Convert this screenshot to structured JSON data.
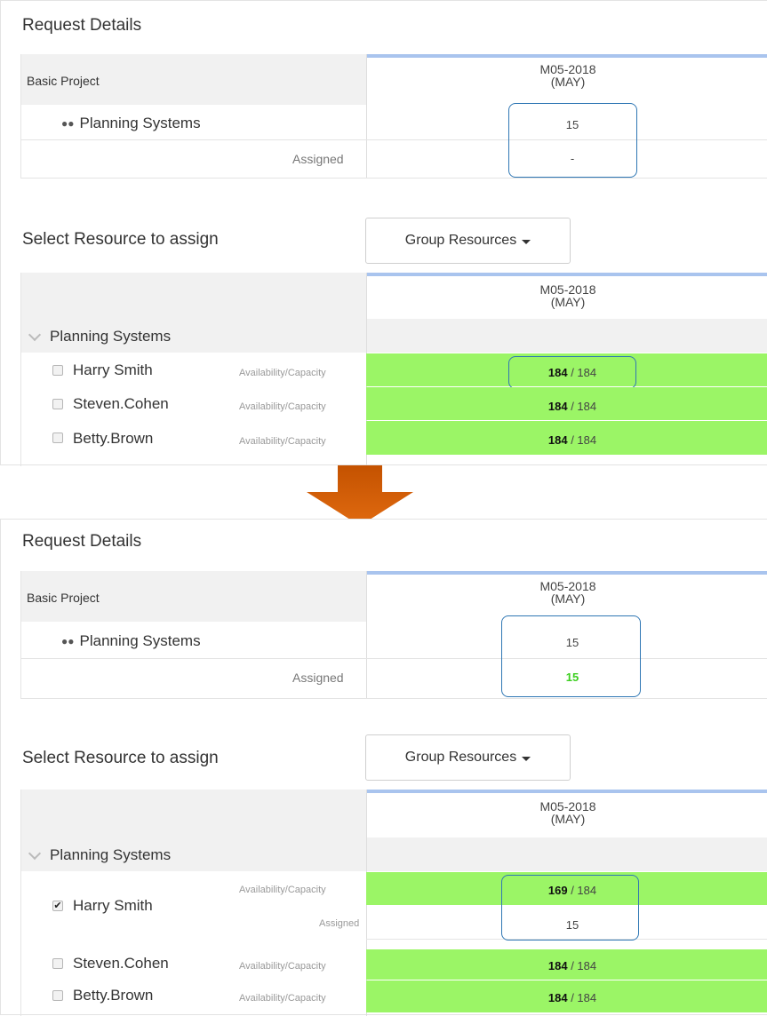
{
  "top": {
    "title": "Request Details",
    "project_name": "Basic Project",
    "group_name": "Planning Systems",
    "assigned_label": "Assigned",
    "month_label": "M05-2018",
    "month_sub": "(MAY)",
    "requested_value": "15",
    "assigned_value": "-",
    "select_label": "Select Resource to assign",
    "group_button": "Group Resources",
    "resource_group": "Planning Systems",
    "resources": [
      {
        "name": "Harry Smith",
        "label": "Availability/Capacity",
        "available": "184",
        "capacity": "184"
      },
      {
        "name": "Steven.Cohen",
        "label": "Availability/Capacity",
        "available": "184",
        "capacity": "184"
      },
      {
        "name": "Betty.Brown",
        "label": "Availability/Capacity",
        "available": "184",
        "capacity": "184"
      }
    ]
  },
  "bottom": {
    "title": "Request Details",
    "project_name": "Basic Project",
    "group_name": "Planning Systems",
    "assigned_label": "Assigned",
    "month_label": "M05-2018",
    "month_sub": "(MAY)",
    "requested_value": "15",
    "assigned_value": "15",
    "select_label": "Select Resource to assign",
    "group_button": "Group Resources",
    "resource_group": "Planning Systems",
    "harry": {
      "name": "Harry Smith",
      "label": "Availability/Capacity",
      "available": "169",
      "capacity": "184",
      "assigned_label": "Assigned",
      "assigned_value": "15"
    },
    "resources": [
      {
        "name": "Steven.Cohen",
        "label": "Availability/Capacity",
        "available": "184",
        "capacity": "184"
      },
      {
        "name": "Betty.Brown",
        "label": "Availability/Capacity",
        "available": "184",
        "capacity": "184"
      }
    ]
  },
  "separator": " / ",
  "colors": {
    "accent_line": "#a9c4ee",
    "available_green": "#9bf566",
    "assigned_green": "#3ccf1f",
    "highlight_box": "#2f77b4",
    "arrow": "#cf5a00"
  }
}
